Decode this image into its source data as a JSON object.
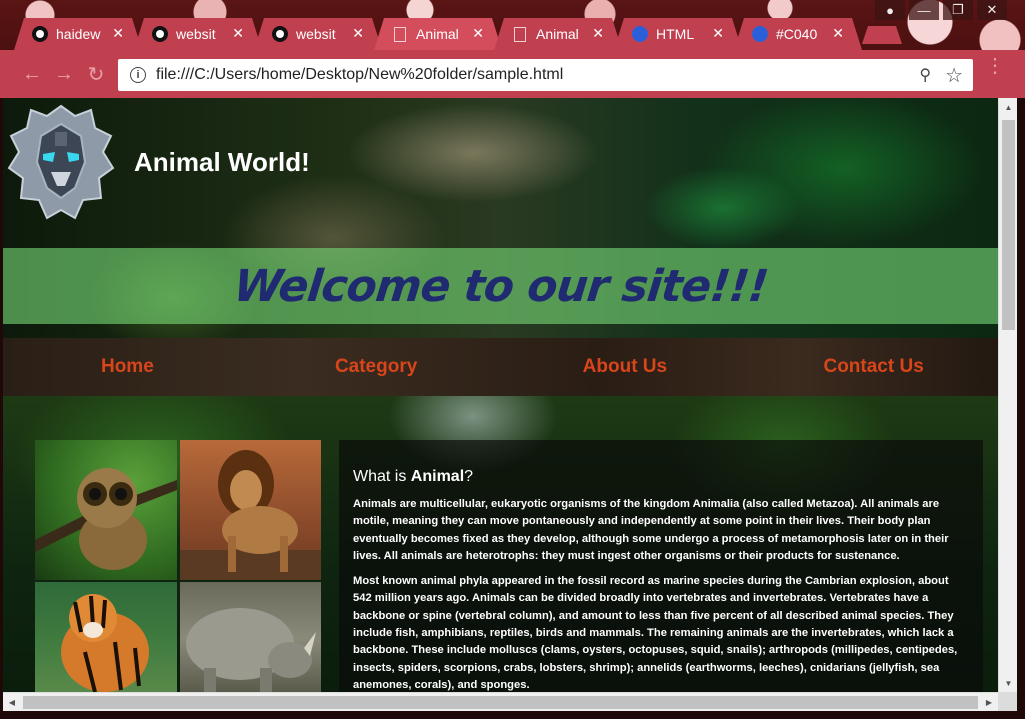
{
  "browser": {
    "tabs": [
      {
        "title": "haidew",
        "icon": "github-icon",
        "active": false
      },
      {
        "title": "websit",
        "icon": "github-icon",
        "active": false
      },
      {
        "title": "websit",
        "icon": "github-icon",
        "active": false
      },
      {
        "title": "Animal",
        "icon": "document-icon",
        "active": true
      },
      {
        "title": "Animal",
        "icon": "document-icon",
        "active": false
      },
      {
        "title": "HTML",
        "icon": "codepen-icon",
        "active": false
      },
      {
        "title": "#C040",
        "icon": "codepen-icon",
        "active": false
      }
    ],
    "tab_close_glyph": "✕",
    "url": "file:///C:/Users/home/Desktop/New%20folder/sample.html",
    "accent_color": "#c04050"
  },
  "page": {
    "site_title": "Animal World!",
    "welcome": "Welcome to our site!!!",
    "nav": [
      "Home",
      "Category",
      "About Us",
      "Contact Us"
    ],
    "nav_color": "#d8451a",
    "article": {
      "heading_prefix": "What is ",
      "heading_bold": "Animal",
      "heading_suffix": "?",
      "paragraphs": [
        "Animals are multicellular, eukaryotic organisms of the kingdom Animalia (also called Metazoa). All animals are motile, meaning they can move pontaneously and independently at some point in their lives. Their body plan eventually becomes fixed as they develop, although some undergo a process of metamorphosis later on in their lives. All animals are heterotrophs: they must ingest other organisms or their products for sustenance.",
        "Most known animal phyla appeared in the fossil record as marine species during the Cambrian explosion, about 542 million years ago. Animals can be divided broadly into vertebrates and invertebrates. Vertebrates have a backbone or spine (vertebral column), and amount to less than five percent of all described animal species. They include fish, amphibians, reptiles, birds and mammals. The remaining animals are the invertebrates, which lack a backbone. These include molluscs (clams, oysters, octopuses, squid, snails); arthropods (millipedes, centipedes, insects, spiders, scorpions, crabs, lobsters, shrimp); annelids (earthworms, leeches), cnidarians (jellyfish, sea anemones, corals), and sponges."
      ]
    },
    "photos": [
      "tarsier",
      "lion",
      "tiger",
      "rhino"
    ]
  }
}
